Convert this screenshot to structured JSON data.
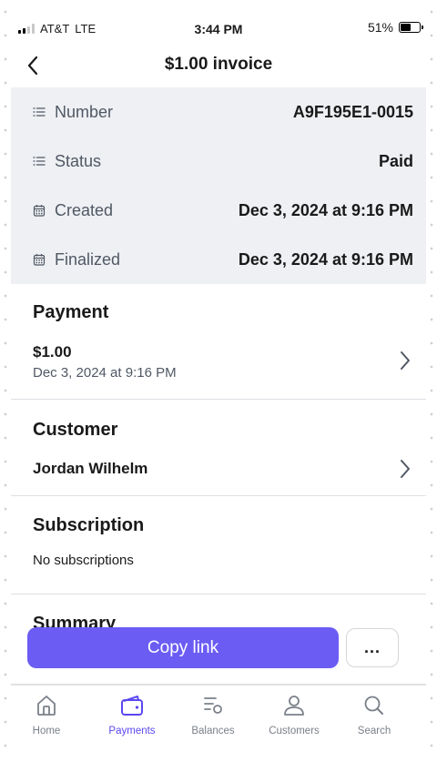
{
  "status_bar": {
    "carrier": "AT&T",
    "network": "LTE",
    "time": "3:44 PM",
    "battery": "51%",
    "battery_level": 0.51
  },
  "nav": {
    "title": "$1.00 invoice"
  },
  "details": [
    {
      "icon": "list-icon",
      "label": "Number",
      "value": "A9F195E1-0015"
    },
    {
      "icon": "list-icon",
      "label": "Status",
      "value": "Paid"
    },
    {
      "icon": "calendar-icon",
      "label": "Created",
      "value": "Dec 3, 2024 at 9:16 PM"
    },
    {
      "icon": "calendar-icon",
      "label": "Finalized",
      "value": "Dec 3, 2024 at 9:16 PM"
    }
  ],
  "payment": {
    "title": "Payment",
    "amount": "$1.00",
    "date": "Dec 3, 2024 at 9:16 PM"
  },
  "customer": {
    "title": "Customer",
    "name": "Jordan Wilhelm"
  },
  "subscription": {
    "title": "Subscription",
    "empty_text": "No subscriptions"
  },
  "summary": {
    "title": "Summary"
  },
  "actions": {
    "copy_link": "Copy link",
    "more": "..."
  },
  "tabs": [
    {
      "label": "Home",
      "icon": "home-icon",
      "active": false
    },
    {
      "label": "Payments",
      "icon": "wallet-icon",
      "active": true
    },
    {
      "label": "Balances",
      "icon": "balances-icon",
      "active": false
    },
    {
      "label": "Customers",
      "icon": "person-icon",
      "active": false
    },
    {
      "label": "Search",
      "icon": "search-icon",
      "active": false
    }
  ],
  "colors": {
    "accent": "#6b5cf4",
    "active_tab": "#5b48f0",
    "details_bg": "#eef0f3"
  }
}
